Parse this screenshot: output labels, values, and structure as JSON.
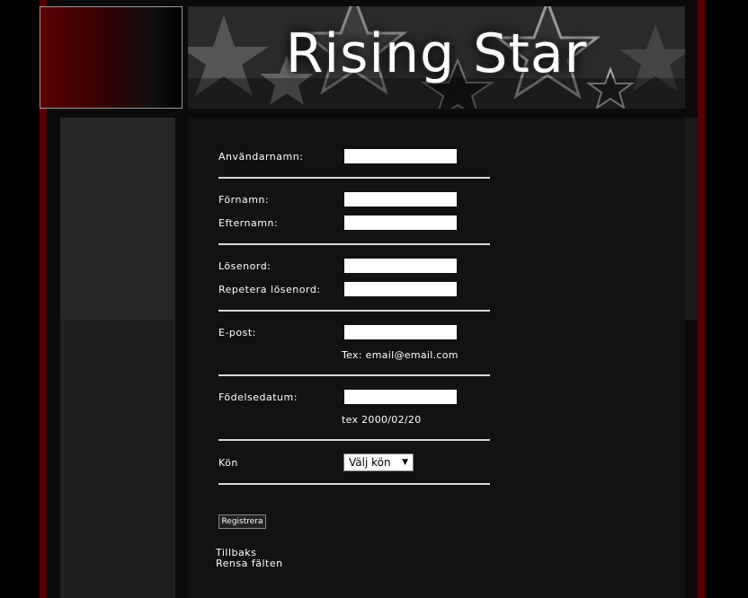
{
  "banner": {
    "title": "Rising Star"
  },
  "form": {
    "username_label": "Användarnamn:",
    "firstname_label": "Förnamn:",
    "lastname_label": "Efternamn:",
    "password_label": "Lösenord:",
    "repeat_password_label": "Repetera lösenord:",
    "email_label": "E-post:",
    "email_hint": "Tex: email@email.com",
    "birthdate_label": "Födelsedatum:",
    "birthdate_hint": "tex 2000/02/20",
    "gender_label": "Kön",
    "gender_select_value": "Välj kön",
    "register_label": "Registrera"
  },
  "links": {
    "back": "Tillbaks",
    "clear": "Rensa fälten"
  },
  "colors": {
    "frame_red": "#5a0000",
    "panel": "#121212",
    "sidebar": "#262626"
  }
}
